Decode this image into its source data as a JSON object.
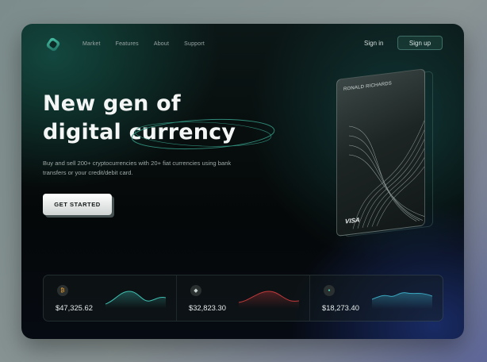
{
  "nav": {
    "links": [
      "Market",
      "Features",
      "About",
      "Support"
    ],
    "signin": "Sign in",
    "signup": "Sign up"
  },
  "hero": {
    "headline_line1": "New gen of",
    "headline_word_a": "digital",
    "headline_word_b": "currency",
    "subtitle": "Buy and sell 200+ cryptocurrencies with 20+ fiat currencies using bank transfers or your credit/debit card.",
    "cta": "GET STARTED"
  },
  "card": {
    "holder": "RONALD RICHARDS",
    "brand": "VISA"
  },
  "ticker": [
    {
      "coin": "bitcoin",
      "symbol": "₿",
      "price": "$47,325.62",
      "trend_color": "#3fbfb0"
    },
    {
      "coin": "ethereum",
      "symbol": "◆",
      "price": "$32,823.30",
      "trend_color": "#c23a3a"
    },
    {
      "coin": "generic-coin",
      "symbol": "●",
      "price": "$18,273.40",
      "trend_color": "#3aa8c0"
    }
  ],
  "colors": {
    "accent": "#3e6e66",
    "text": "#f3f6f5"
  }
}
